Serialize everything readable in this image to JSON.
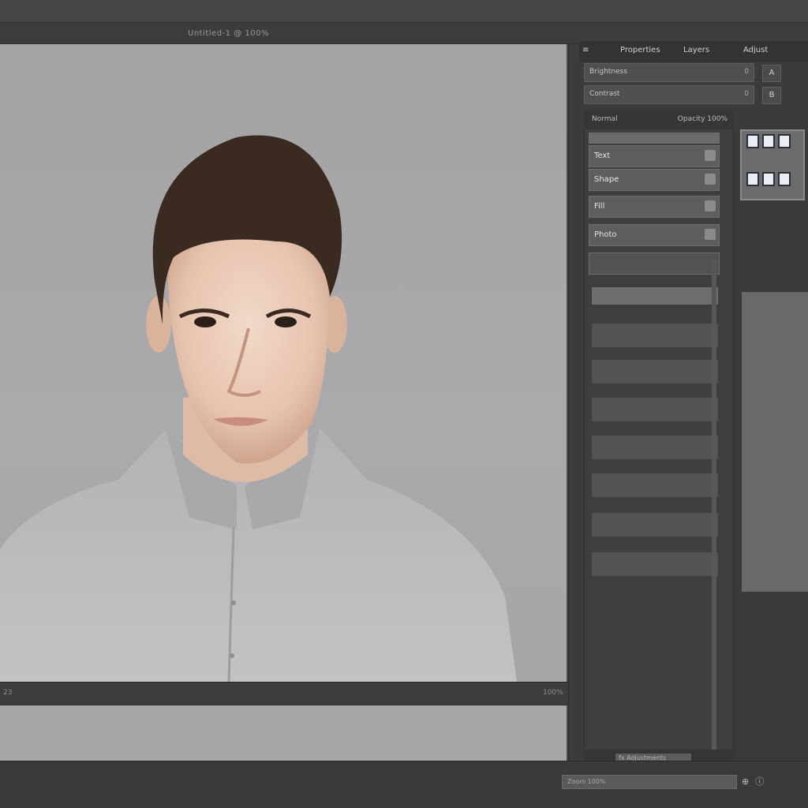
{
  "app": {
    "document_title": "Untitled-1 @ 100%"
  },
  "panels": {
    "tabs": [
      "Properties",
      "Layers",
      "Adjust"
    ],
    "property_rows": [
      {
        "label": "Brightness",
        "value": "0"
      },
      {
        "label": "Contrast",
        "value": "0"
      }
    ],
    "side_buttons": [
      "A",
      "B"
    ]
  },
  "layers": {
    "header_left": "Normal",
    "header_right": "Opacity 100%",
    "items": [
      {
        "label": "Text"
      },
      {
        "label": "Shape"
      },
      {
        "label": "Fill"
      },
      {
        "label": "Photo"
      }
    ],
    "footer_label": "fx  Adjustments"
  },
  "status": {
    "left": "23",
    "right": "100%"
  },
  "zoom": {
    "label": "Zoom 100%"
  },
  "colors": {
    "chrome": "#3b3b3d",
    "canvas": "#a7a7a9",
    "accent": "#5e5e60"
  },
  "icons": [
    "menu-icon",
    "eye-icon",
    "lock-icon",
    "zoom-in-icon",
    "info-icon"
  ]
}
